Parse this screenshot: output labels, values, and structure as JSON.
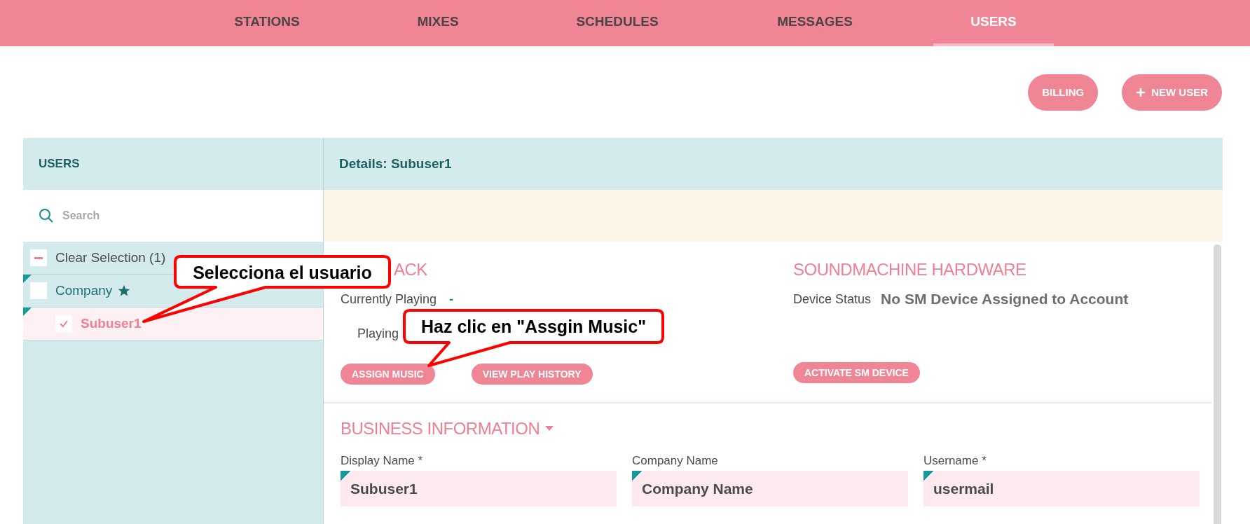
{
  "nav": {
    "tabs": [
      {
        "label": "STATIONS",
        "selected": false
      },
      {
        "label": "MIXES",
        "selected": false
      },
      {
        "label": "SCHEDULES",
        "selected": false
      },
      {
        "label": "MESSAGES",
        "selected": false
      },
      {
        "label": "USERS",
        "selected": true
      }
    ]
  },
  "actions": [
    {
      "label": "BILLING",
      "kind": "plain"
    },
    {
      "label": "NEW USER",
      "kind": "add"
    }
  ],
  "users_panel": {
    "title": "USERS",
    "search": {
      "placeholder": "Search"
    },
    "items": [
      {
        "kind": "clear",
        "label": "Clear Selection (1)",
        "selected": false
      },
      {
        "kind": "group",
        "label": "Company",
        "starred": true,
        "checked": false,
        "selected": false
      },
      {
        "kind": "user",
        "label": "Subuser1",
        "starred": false,
        "checked": true,
        "selected": true
      }
    ]
  },
  "details": {
    "title": "Details: Subuser1",
    "playback": {
      "title": "ACK",
      "currently_playing_label": "Currently Playing",
      "currently_playing_value": "-",
      "playing_label": "Playing",
      "buttons": [
        "ASSIGN MUSIC",
        "VIEW PLAY HISTORY"
      ]
    },
    "hardware": {
      "title": "SOUNDMACHINE HARDWARE",
      "status_label": "Device Status",
      "status_value": "No SM Device Assigned to Account",
      "buttons": [
        "ACTIVATE SM DEVICE"
      ]
    },
    "business": {
      "title": "BUSINESS INFORMATION",
      "fields": [
        {
          "label": "Display Name *",
          "value": "Subuser1"
        },
        {
          "label": "Company Name",
          "value": "Company Name"
        },
        {
          "label": "Username *",
          "value": "usermail"
        }
      ]
    }
  },
  "callouts": [
    {
      "text": "Selecciona el usuario"
    },
    {
      "text": "Haz clic en \"Assgin Music\""
    }
  ]
}
